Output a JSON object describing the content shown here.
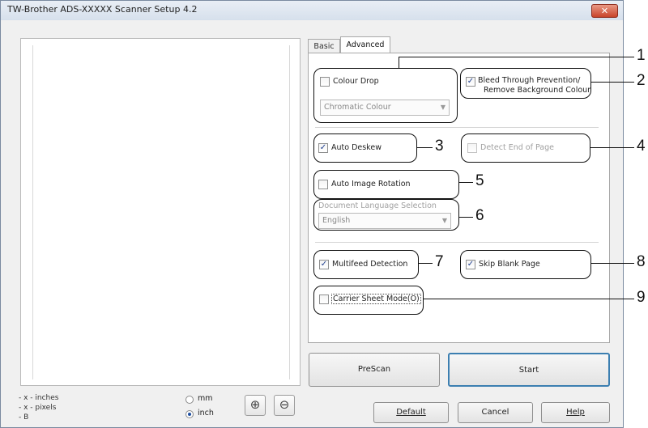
{
  "window": {
    "title": "TW-Brother ADS-XXXXX Scanner Setup 4.2",
    "close_label": "✕"
  },
  "info": {
    "inches": "- x - inches",
    "pixels": "- x - pixels",
    "bits": "- B"
  },
  "units": {
    "mm_label": "mm",
    "inch_label": "inch",
    "selected": "inch"
  },
  "zoom": {
    "in_symbol": "⊕",
    "out_symbol": "⊖"
  },
  "tabs": [
    {
      "label": "Basic",
      "active": false
    },
    {
      "label": "Advanced",
      "active": true
    }
  ],
  "options": {
    "colour_drop": {
      "label": "Colour Drop",
      "checked": false
    },
    "colour_combo": {
      "value": "Chromatic Colour"
    },
    "bleed_through": {
      "line1": "Bleed Through Prevention/",
      "line2": "Remove Background Colour",
      "checked": true
    },
    "auto_deskew": {
      "label": "Auto Deskew",
      "checked": true
    },
    "detect_end": {
      "label": "Detect End of Page",
      "checked": false,
      "enabled": false
    },
    "auto_rotation": {
      "label": "Auto Image Rotation",
      "checked": false
    },
    "doc_language": {
      "label": "Document Language Selection",
      "value": "English"
    },
    "multifeed": {
      "label": "Multifeed Detection",
      "checked": true
    },
    "skip_blank": {
      "label": "Skip Blank Page",
      "checked": true
    },
    "carrier_sheet": {
      "label": "Carrier Sheet Mode(O)",
      "checked": false
    }
  },
  "callouts": [
    "1",
    "2",
    "3",
    "4",
    "5",
    "6",
    "7",
    "8",
    "9"
  ],
  "buttons": {
    "prescan": "PreScan",
    "start": "Start",
    "default": "Default",
    "cancel": "Cancel",
    "help": "Help"
  },
  "colors": {
    "check_mark": "#1f3f8f",
    "close_button": "#c8432a",
    "start_border": "#3c7fb1"
  }
}
